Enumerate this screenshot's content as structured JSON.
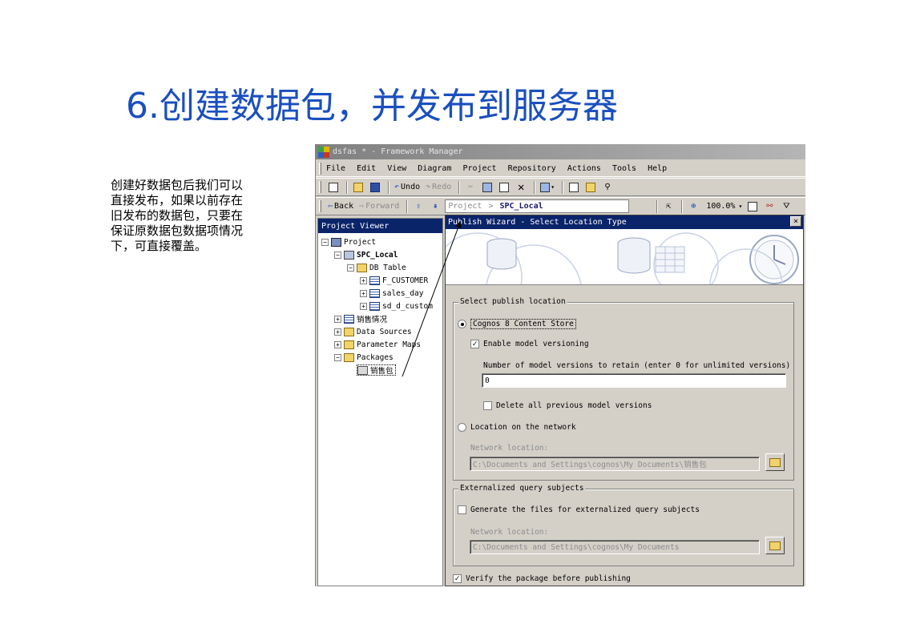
{
  "slide": {
    "title": "6.创建数据包，并发布到服务器",
    "description": "创建好数据包后我们可以直接发布，如果以前存在旧发布的数据包，只要在保证原数据包数据项情况下，可直接覆盖。"
  },
  "window": {
    "title": "dsfas * - Framework Manager",
    "menu": [
      "File",
      "Edit",
      "View",
      "Diagram",
      "Project",
      "Repository",
      "Actions",
      "Tools",
      "Help"
    ],
    "toolbar": {
      "undo": "Undo",
      "redo": "Redo",
      "back": "Back",
      "forward": "Forward",
      "crumb_root": "Project",
      "crumb_sep": ">",
      "crumb_current": "SPC_Local",
      "zoom": "100.0%"
    }
  },
  "project_viewer": {
    "header": "Project Viewer",
    "items": [
      {
        "expander": "−",
        "label": "Project"
      },
      {
        "expander": "−",
        "label": "SPC_Local"
      },
      {
        "expander": "−",
        "label": "DB Table"
      },
      {
        "expander": "+",
        "label": "F_CUSTOMER"
      },
      {
        "expander": "+",
        "label": "sales_day"
      },
      {
        "expander": "+",
        "label": "sd_d_custom"
      },
      {
        "expander": "+",
        "label": "销售情况"
      },
      {
        "expander": "+",
        "label": "Data Sources"
      },
      {
        "expander": "+",
        "label": "Parameter Maps"
      },
      {
        "expander": "−",
        "label": "Packages"
      },
      {
        "expander": "",
        "label": "销售包"
      }
    ]
  },
  "wizard": {
    "title": "Publish Wizard - Select Location Type",
    "close": "×",
    "publish_location": {
      "group_label": "Select publish location",
      "content_store_label": "Cognos 8 Content Store",
      "versioning_label": "Enable model versioning",
      "versions_prompt": "Number of model versions to retain (enter 0 for unlimited versions)",
      "versions_value": "0",
      "delete_versions_label": "Delete all previous model versions",
      "network_option_label": "Location on the network",
      "network_location_label": "Network location:",
      "network_location_value": "C:\\Documents and Settings\\cognos\\My Documents\\销售包"
    },
    "externalized": {
      "group_label": "Externalized query subjects",
      "generate_label": "Generate the files for externalized query subjects",
      "network_location_label": "Network location:",
      "network_location_value": "C:\\Documents and Settings\\cognos\\My Documents"
    },
    "verify_label": "Verify the package before publishing",
    "checks": {
      "content_store": true,
      "versioning": true,
      "delete_versions": false,
      "network": false,
      "generate": false,
      "verify": true
    }
  },
  "colors": {
    "title_blue": "#1a4fbf",
    "caption_navy": "#0a246a",
    "chrome_gray": "#d4d0c8"
  }
}
